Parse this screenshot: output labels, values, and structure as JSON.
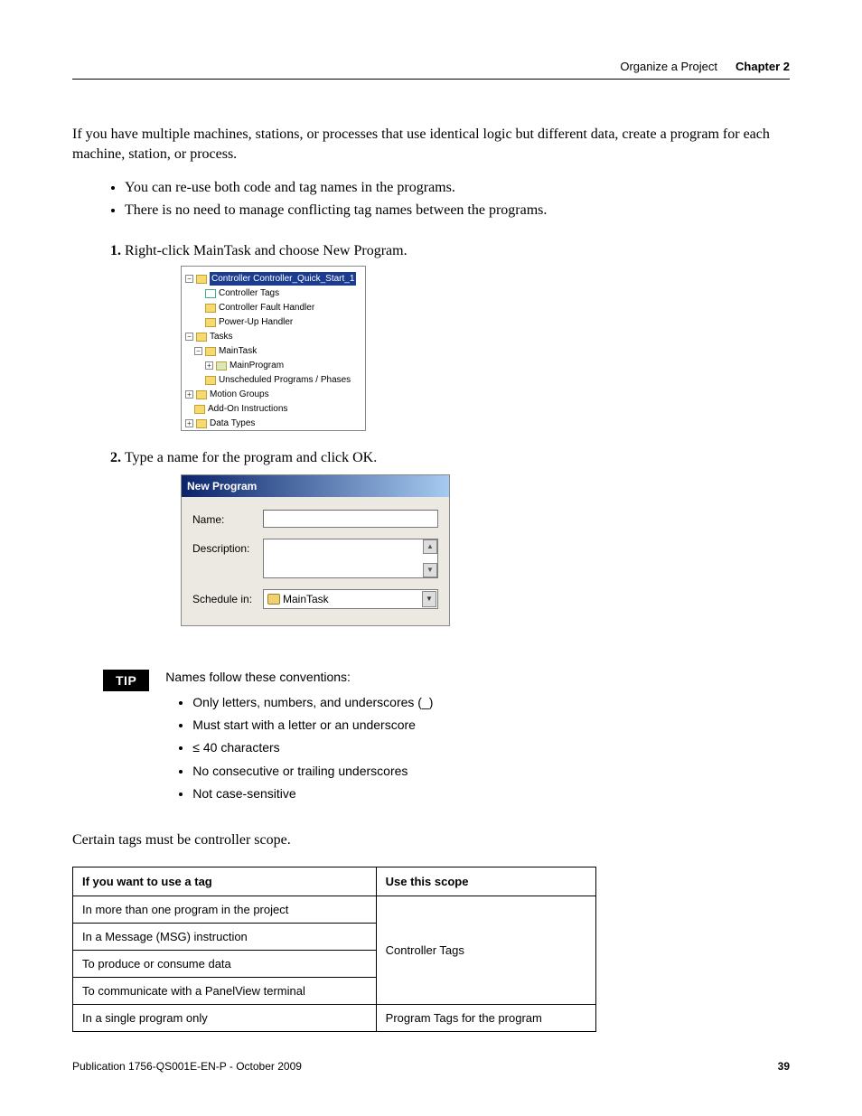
{
  "header": {
    "section": "Organize a Project",
    "chapter": "Chapter 2"
  },
  "intro": "If you have multiple machines, stations, or processes that use identical logic but different data, create a program for each machine, station, or process.",
  "bullets": [
    "You can re-use both code and tag names in the programs.",
    "There is no need to manage conflicting tag names between the programs."
  ],
  "steps": [
    "Right-click MainTask and choose New Program.",
    "Type a name for the program and click OK."
  ],
  "tree": {
    "root": "Controller Controller_Quick_Start_1",
    "items": [
      "Controller Tags",
      "Controller Fault Handler",
      "Power-Up Handler"
    ],
    "tasks": "Tasks",
    "maintask": "MainTask",
    "mainprogram": "MainProgram",
    "unscheduled": "Unscheduled Programs / Phases",
    "motion": "Motion Groups",
    "addon": "Add-On Instructions",
    "datatypes": "Data Types"
  },
  "dialog": {
    "title": "New Program",
    "name_label": "Name:",
    "desc_label": "Description:",
    "schedule_label": "Schedule in:",
    "schedule_value": "MainTask"
  },
  "tip": {
    "badge": "TIP",
    "intro": "Names follow these conventions:",
    "items": [
      "Only letters, numbers, and underscores (_)",
      "Must start with a letter or an underscore",
      "≤ 40 characters",
      "No consecutive or trailing underscores",
      "Not case-sensitive"
    ]
  },
  "scope_intro": "Certain tags must be controller scope.",
  "table": {
    "h1": "If you want to use a tag",
    "h2": "Use this scope",
    "rows": [
      "In more than one program in the project",
      "In a Message (MSG) instruction",
      "To produce or consume data",
      "To communicate with a PanelView terminal"
    ],
    "merged": "Controller Tags",
    "last_left": "In a single program only",
    "last_right": "Program Tags for the program"
  },
  "footer": {
    "pub": "Publication 1756-QS001E-EN-P - October 2009",
    "page": "39"
  }
}
